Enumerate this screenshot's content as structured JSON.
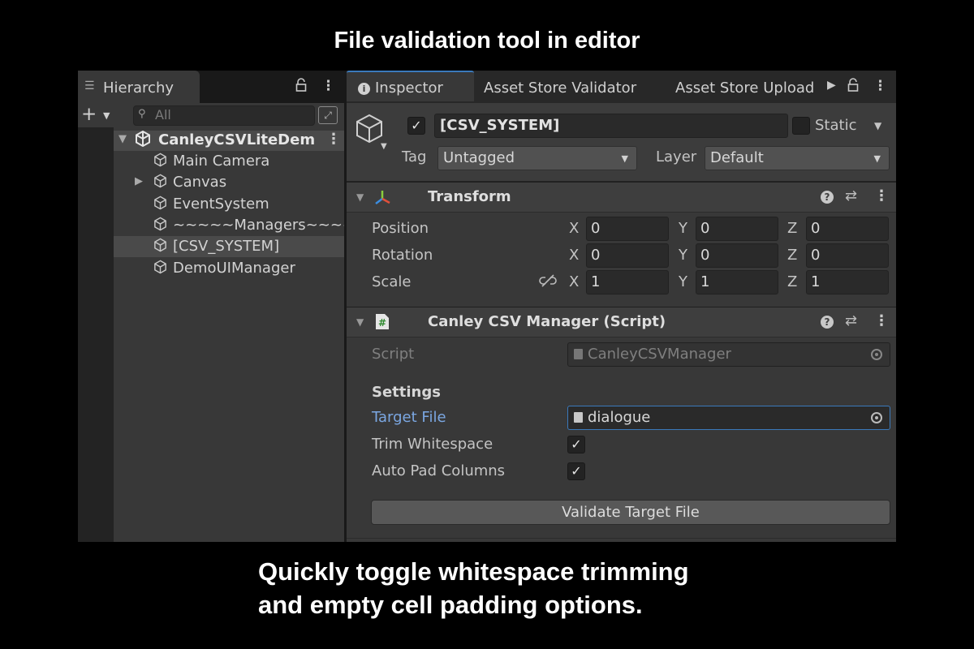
{
  "headline": "File validation tool in editor",
  "caption": {
    "line1": "Quickly toggle whitespace trimming",
    "line2": "and empty cell padding options."
  },
  "hierarchy": {
    "tab_label": "Hierarchy",
    "search_placeholder": "All",
    "scene_name": "CanleyCSVLiteDem",
    "objects": [
      {
        "name": "Main Camera",
        "has_children": false,
        "selected": false
      },
      {
        "name": "Canvas",
        "has_children": true,
        "selected": false
      },
      {
        "name": "EventSystem",
        "has_children": false,
        "selected": false
      },
      {
        "name": "~~~~~Managers~~~~",
        "has_children": false,
        "selected": false
      },
      {
        "name": "[CSV_SYSTEM]",
        "has_children": false,
        "selected": true
      },
      {
        "name": "DemoUIManager",
        "has_children": false,
        "selected": false
      }
    ]
  },
  "inspector": {
    "tabs": [
      "Inspector",
      "Asset Store Validator",
      "Asset Store Upload"
    ],
    "object": {
      "active": true,
      "name": "[CSV_SYSTEM]",
      "static_label": "Static",
      "static": false,
      "tag_label": "Tag",
      "tag_value": "Untagged",
      "layer_label": "Layer",
      "layer_value": "Default"
    },
    "transform": {
      "title": "Transform",
      "rows": [
        {
          "label": "Position",
          "x": "0",
          "y": "0",
          "z": "0"
        },
        {
          "label": "Rotation",
          "x": "0",
          "y": "0",
          "z": "0"
        },
        {
          "label": "Scale",
          "x": "1",
          "y": "1",
          "z": "1"
        }
      ],
      "axis_labels": [
        "X",
        "Y",
        "Z"
      ]
    },
    "csv_manager": {
      "title": "Canley CSV Manager (Script)",
      "script_label": "Script",
      "script_value": "CanleyCSVManager",
      "settings_header": "Settings",
      "target_file_label": "Target File",
      "target_file_value": "dialogue",
      "trim_whitespace_label": "Trim Whitespace",
      "trim_whitespace": true,
      "auto_pad_label": "Auto Pad Columns",
      "auto_pad": true,
      "validate_button": "Validate Target File"
    }
  },
  "colors": {
    "accent_blue": "#3a79bb",
    "label_blue": "#7ba7e2",
    "panel": "#383838",
    "selection": "#4a4a4a"
  },
  "icons": [
    "hierarchy-menu-icon",
    "lock-icon",
    "kebab-menu-icon",
    "search-icon",
    "unity-scene-icon",
    "gameobject-cube-icon",
    "info-icon",
    "transform-gizmo-icon",
    "script-hash-icon",
    "help-icon",
    "preset-icon",
    "unlink-scale-icon",
    "object-picker-icon",
    "file-icon"
  ]
}
